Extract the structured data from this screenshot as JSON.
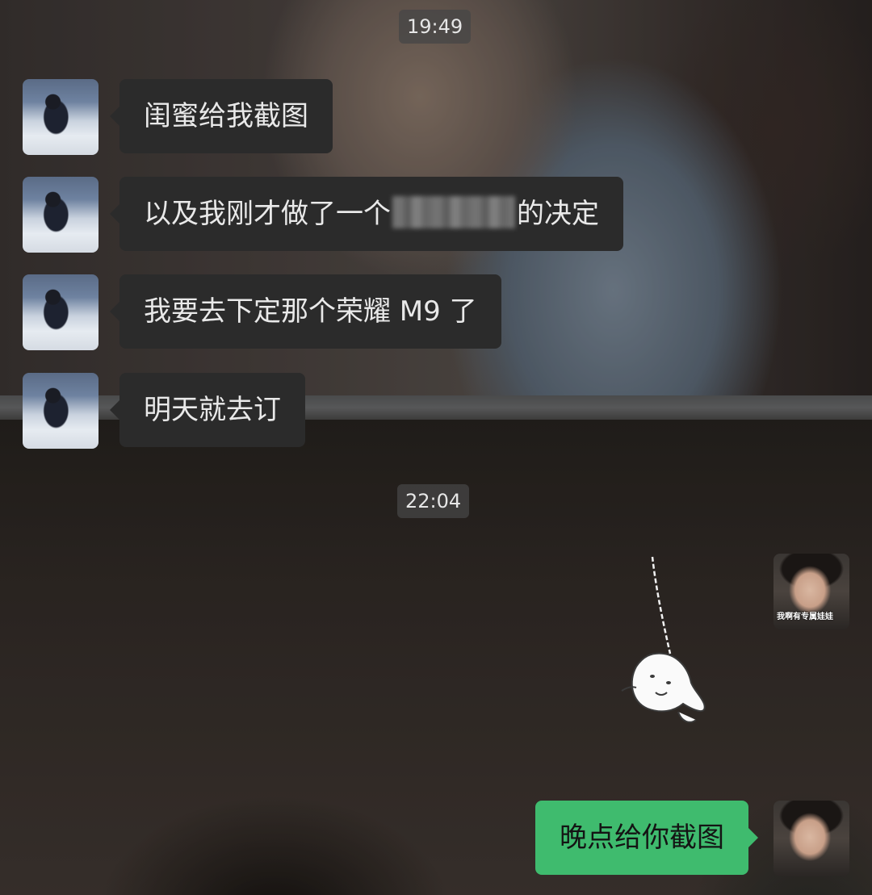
{
  "timestamps": [
    "19:49",
    "22:04"
  ],
  "messages": [
    {
      "side": "incoming",
      "text": "闺蜜给我截图"
    },
    {
      "side": "incoming",
      "text_before": "以及我刚才做了一个",
      "text_after": "的决定",
      "redacted": true
    },
    {
      "side": "incoming",
      "text": "我要去下定那个荣耀 M9 了"
    },
    {
      "side": "incoming",
      "text": "明天就去订"
    },
    {
      "side": "outgoing",
      "type": "sticker",
      "icon": "cartoon-ghost-sticker"
    },
    {
      "side": "outgoing",
      "text": "晚点给你截图"
    }
  ],
  "outgoing_avatar_caption": "我啊有专属娃娃",
  "colors": {
    "incoming_bubble": "#2b2b2b",
    "outgoing_bubble": "#3fbb6e",
    "timestamp_bg": "#464646"
  }
}
